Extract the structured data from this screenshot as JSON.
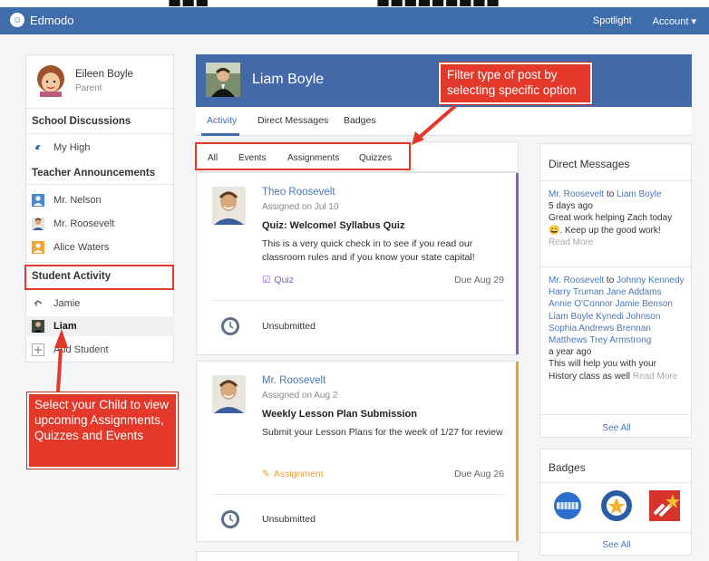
{
  "app": {
    "brand": "Edmodo"
  },
  "topnav": {
    "spotlight": "Spotlight",
    "account": "Account ▾"
  },
  "profile": {
    "name": "Eileen Boyle",
    "role": "Parent"
  },
  "sidebar": {
    "school_title": "School Discussions",
    "school_items": [
      "My High"
    ],
    "teacher_title": "Teacher Announcements",
    "teachers": [
      "Mr. Nelson",
      "Mr. Roosevelt",
      "Alice Waters"
    ],
    "student_title": "Student Activity",
    "students": [
      "Jamie",
      "Liam"
    ],
    "add_student": "Add Student"
  },
  "hero": {
    "name": "Liam Boyle"
  },
  "tabs": [
    "Activity",
    "Direct Messages",
    "Badges"
  ],
  "filters": [
    "All",
    "Events",
    "Assignments",
    "Quizzes"
  ],
  "posts": [
    {
      "author": "Theo Roosevelt",
      "assigned": "Assigned on Jul 10",
      "title": "Quiz: Welcome! Syllabus Quiz",
      "body": "This is a very quick check in to see if you read our classroom rules and if you know your state capital!",
      "type": "Quiz",
      "due": "Due Aug 29",
      "status": "Unsubmitted"
    },
    {
      "author": "Mr. Roosevelt",
      "assigned": "Assigned on Aug 2",
      "title": "Weekly Lesson Plan Submission",
      "body": "Submit your Lesson Plans for the week of 1/27 for review",
      "type": "Assignment",
      "due": "Due Aug 26",
      "status": "Unsubmitted"
    }
  ],
  "direct_messages": {
    "title": "Direct Messages",
    "msg1": {
      "from": "Mr. Roosevelt",
      "to_word": "to",
      "to": "Liam Boyle",
      "time": "5 days ago",
      "text1": "Great work helping Zach today",
      "text2": ". Keep up the good work!",
      "more": "Read More"
    },
    "msg2": {
      "from": "Mr. Roosevelt",
      "to_word": "to",
      "recipients_line1": "Johnny",
      "recipients_rest": "Kennedy Harry Truman Jane Addams Annie O'Connor Jamie Benson Liam Boyle Kynedi Johnson Sophia Andrews Brennan Matthews Trey Armstrong",
      "time": "a year ago",
      "text": "This will help you with your History class as well",
      "more": "Read More"
    },
    "see_all": "See All"
  },
  "badges": {
    "title": "Badges",
    "see_all": "See All"
  },
  "annotations": {
    "filter_note": "Filter type of post by selecting specific option",
    "child_note": "Select your Child to view upcoming Assignments, Quizzes and Events"
  },
  "colors": {
    "brand_blue": "#3f6dac",
    "hero_blue": "#4469a8",
    "link_blue": "#4a77b4",
    "highlight_red": "#e4382b",
    "quiz_purple": "#8a5cc9",
    "assignment_orange": "#e8a23a"
  }
}
